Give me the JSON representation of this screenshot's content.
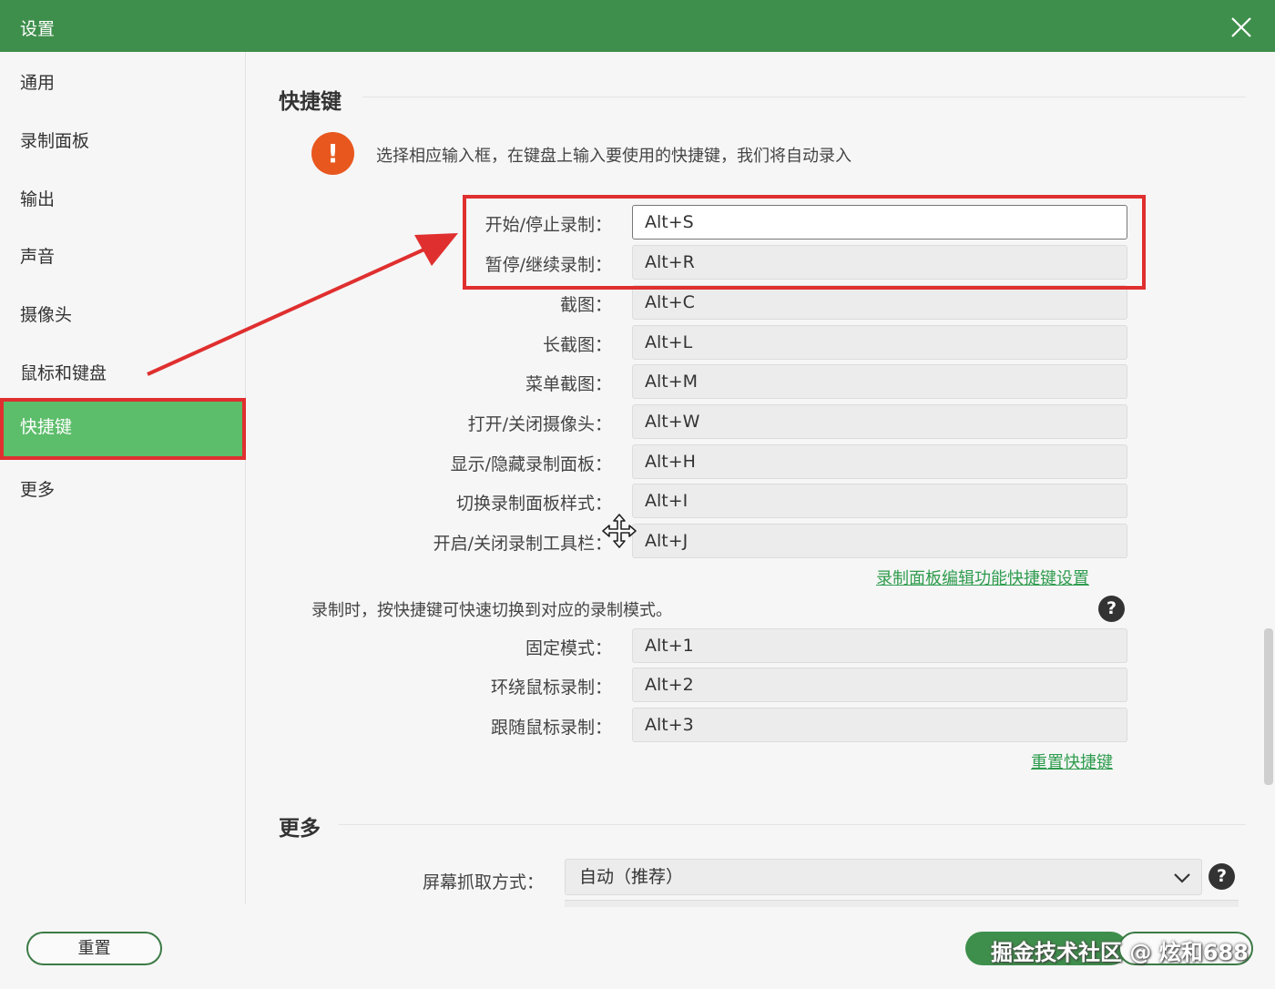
{
  "window": {
    "title": "设置",
    "close_icon": "close-icon"
  },
  "sidebar": {
    "items": [
      {
        "label": "通用",
        "active": false
      },
      {
        "label": "录制面板",
        "active": false
      },
      {
        "label": "输出",
        "active": false
      },
      {
        "label": "声音",
        "active": false
      },
      {
        "label": "摄像头",
        "active": false
      },
      {
        "label": "鼠标和键盘",
        "active": false
      },
      {
        "label": "快捷键",
        "active": true
      },
      {
        "label": "更多",
        "active": false
      }
    ]
  },
  "hotkeys": {
    "title": "快捷键",
    "info": "选择相应输入框，在键盘上输入要使用的快捷键，我们将自动录入",
    "rows": [
      {
        "label": "开始/停止录制：",
        "value": "Alt+S"
      },
      {
        "label": "暂停/继续录制：",
        "value": "Alt+R"
      },
      {
        "label": "截图：",
        "value": "Alt+C"
      },
      {
        "label": "长截图：",
        "value": "Alt+L"
      },
      {
        "label": "菜单截图：",
        "value": "Alt+M"
      },
      {
        "label": "打开/关闭摄像头：",
        "value": "Alt+W"
      },
      {
        "label": "显示/隐藏录制面板：",
        "value": "Alt+H"
      },
      {
        "label": "切换录制面板样式：",
        "value": "Alt+I"
      },
      {
        "label": "开启/关闭录制工具栏：",
        "value": "Alt+J"
      }
    ],
    "panel_edit_link": "录制面板编辑功能快捷键设置",
    "mode_desc": "录制时，按快捷键可快速切换到对应的录制模式。",
    "mode_rows": [
      {
        "label": "固定模式：",
        "value": "Alt+1"
      },
      {
        "label": "环绕鼠标录制：",
        "value": "Alt+2"
      },
      {
        "label": "跟随鼠标录制：",
        "value": "Alt+3"
      }
    ],
    "reset_link": "重置快捷键"
  },
  "more": {
    "title": "更多",
    "capture_label": "屏幕抓取方式：",
    "capture_value": "自动（推荐）"
  },
  "footer": {
    "reset_label": "重置",
    "watermark": "掘金技术社区 @ 炫和688"
  },
  "colors": {
    "accent": "#3f8f4c",
    "active_nav": "#5cbd6a",
    "highlight": "#e02f2f",
    "info_icon": "#e8571e",
    "link": "#2f9c4e"
  }
}
